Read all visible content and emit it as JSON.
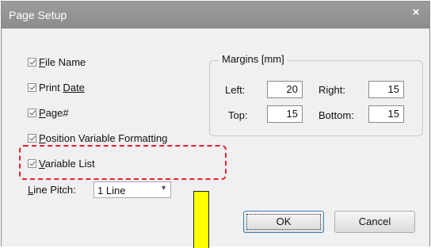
{
  "window": {
    "title": "Page Setup",
    "close_glyph": "×"
  },
  "checkboxes": [
    {
      "label_first": "F",
      "label_rest": "ile Name",
      "checked": true
    },
    {
      "label_first": "Print ",
      "label_rest": "Date",
      "checked": true
    },
    {
      "label_first": "P",
      "label_rest": "age#",
      "checked": true
    },
    {
      "label_first": "P",
      "label_rest": "osition Variable Formatting",
      "checked": true
    },
    {
      "label_first": "V",
      "label_rest": "ariable List",
      "checked": true
    }
  ],
  "line_pitch": {
    "label_first": "L",
    "label_rest": "ine Pitch:",
    "value": "1 Line"
  },
  "margins": {
    "title": "Margins [mm]",
    "left_label": "Left:",
    "left_value": "20",
    "right_label": "Right:",
    "right_value": "15",
    "top_label": "Top:",
    "top_value": "15",
    "bottom_label": "Bottom:",
    "bottom_value": "15"
  },
  "buttons": {
    "ok": "OK",
    "cancel": "Cancel"
  },
  "colors": {
    "highlight": "#e0232b",
    "marker": "#ffff00",
    "titlebar": "#959595"
  }
}
